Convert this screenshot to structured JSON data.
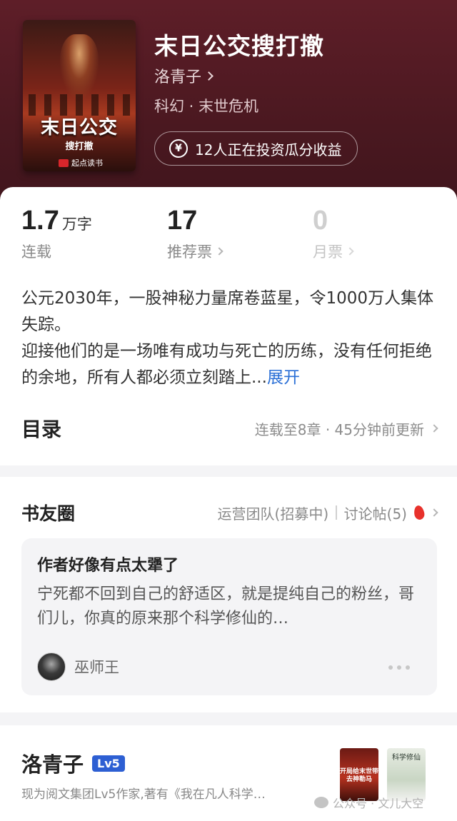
{
  "book": {
    "cover": {
      "title": "末日公交",
      "subtitle": "搜打撤",
      "publisher": "起点读书"
    },
    "title": "末日公交搜打撤",
    "author": "洛青子",
    "genre": "科幻 · 末世危机",
    "invest_text": "12人正在投资瓜分收益",
    "yen_symbol": "¥"
  },
  "stats": [
    {
      "value": "1.7",
      "unit": "万字",
      "label": "连载"
    },
    {
      "value": "17",
      "label": "推荐票"
    },
    {
      "value": "0",
      "label": "月票"
    }
  ],
  "synopsis": {
    "text": "公元2030年，一股神秘力量席卷蓝星，令1000万人集体失踪。迎接他们的是一场唯有成功与死亡的历练，没有任何拒绝的余地，所有人都必须立刻踏上...",
    "line1": "公元2030年，一股神秘力量席卷蓝星，令1000万人集体失踪。",
    "line2": "迎接他们的是一场唯有成功与死亡的历练，没有任何拒绝的余地，所有人都必须立刻踏上...",
    "expand": "展开"
  },
  "toc": {
    "title": "目录",
    "info": "连载至8章 · 45分钟前更新"
  },
  "circle": {
    "title": "书友圈",
    "ops_team": "运营团队(招募中)",
    "discussions": "讨论帖(5)",
    "post": {
      "title": "作者好像有点太犟了",
      "body": "宁死都不回到自己的舒适区，就是提纯自己的粉丝，哥们儿，你真的原来那个科学修仙的…",
      "user": "巫师王"
    }
  },
  "author_card": {
    "name": "洛青子",
    "level": "Lv5",
    "desc": "现为阅文集团Lv5作家,著有《我在凡人科学…",
    "work1_text": "开局给末世带去神勒马",
    "work2_text": "科学修仙"
  },
  "watermark": "公众号 · 文儿大空",
  "colors": {
    "header_bg": "#4a1820",
    "accent_blue": "#2a6fd6",
    "level_badge": "#2d5fd3",
    "fire": "#e8322c"
  }
}
